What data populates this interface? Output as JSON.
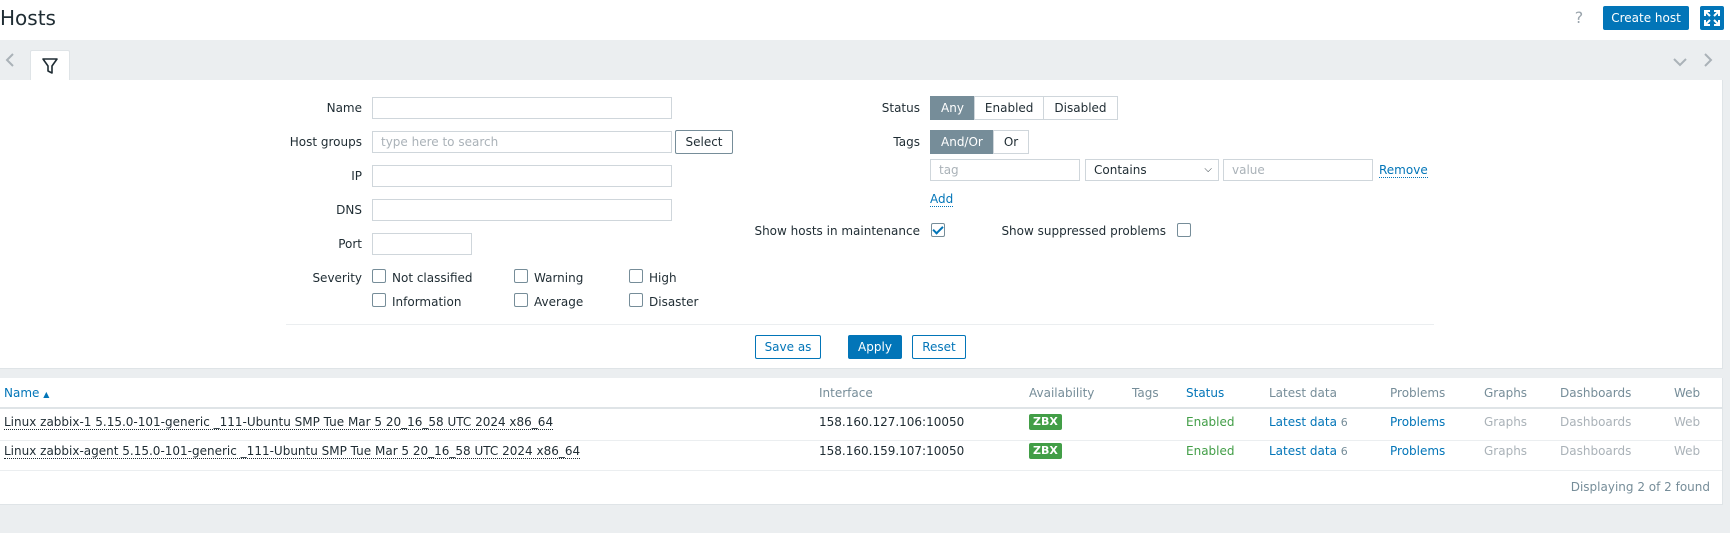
{
  "header": {
    "title": "Hosts",
    "help_label": "?",
    "create_button": "Create host"
  },
  "filter": {
    "fields": {
      "name_label": "Name",
      "name_value": "",
      "host_groups_label": "Host groups",
      "host_groups_placeholder": "type here to search",
      "select_button": "Select",
      "ip_label": "IP",
      "ip_value": "",
      "dns_label": "DNS",
      "dns_value": "",
      "port_label": "Port",
      "port_value": ""
    },
    "severity": {
      "label": "Severity",
      "options": [
        "Not classified",
        "Warning",
        "High",
        "Information",
        "Average",
        "Disaster"
      ]
    },
    "status": {
      "label": "Status",
      "options": [
        "Any",
        "Enabled",
        "Disabled"
      ],
      "selected": "Any"
    },
    "tags": {
      "label": "Tags",
      "options": [
        "And/Or",
        "Or"
      ],
      "selected": "And/Or",
      "tag_placeholder": "tag",
      "operator": "Contains",
      "value_placeholder": "value",
      "remove_link": "Remove",
      "add_link": "Add"
    },
    "maintenance": {
      "label": "Show hosts in maintenance",
      "checked": true
    },
    "suppressed": {
      "label": "Show suppressed problems",
      "checked": false
    },
    "buttons": {
      "save_as": "Save as",
      "apply": "Apply",
      "reset": "Reset"
    }
  },
  "table": {
    "columns": [
      "Name",
      "Interface",
      "Availability",
      "Tags",
      "Status",
      "Latest data",
      "Problems",
      "Graphs",
      "Dashboards",
      "Web"
    ],
    "sort_indicator": "▲",
    "rows": [
      {
        "name": "Linux zabbix-1 5.15.0-101-generic _111-Ubuntu SMP Tue Mar 5 20_16_58 UTC 2024 x86_64",
        "interface": "158.160.127.106:10050",
        "availability": "ZBX",
        "status": "Enabled",
        "latest_data": "Latest data",
        "latest_count": "6",
        "problems": "Problems",
        "graphs": "Graphs",
        "dashboards": "Dashboards",
        "web": "Web"
      },
      {
        "name": "Linux zabbix-agent 5.15.0-101-generic _111-Ubuntu SMP Tue Mar 5 20_16_58 UTC 2024 x86_64",
        "interface": "158.160.159.107:10050",
        "availability": "ZBX",
        "status": "Enabled",
        "latest_data": "Latest data",
        "latest_count": "6",
        "problems": "Problems",
        "graphs": "Graphs",
        "dashboards": "Dashboards",
        "web": "Web"
      }
    ],
    "footer": "Displaying 2 of 2 found"
  },
  "colors": {
    "accent": "#0275b8",
    "enabled": "#429e47",
    "segment_active": "#768d99",
    "page_bg": "#ebeef0"
  }
}
